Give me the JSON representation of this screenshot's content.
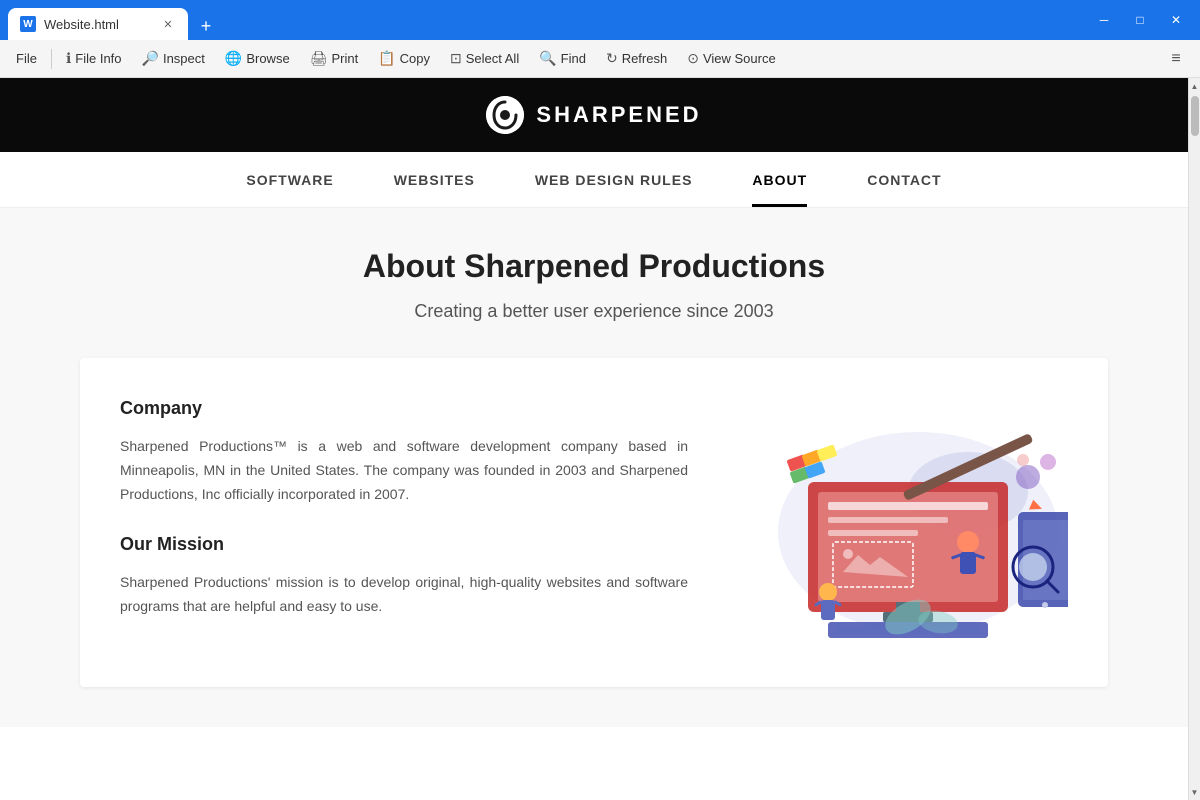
{
  "titlebar": {
    "tab_title": "Website.html",
    "new_tab_label": "+",
    "minimize_icon": "─",
    "restore_icon": "□",
    "close_icon": "✕"
  },
  "toolbar": {
    "file_label": "File",
    "file_info_label": "File Info",
    "inspect_label": "Inspect",
    "browse_label": "Browse",
    "print_label": "Print",
    "copy_label": "Copy",
    "select_all_label": "Select All",
    "find_label": "Find",
    "refresh_label": "Refresh",
    "view_source_label": "View Source",
    "menu_icon": "≡"
  },
  "site": {
    "logo_text": "SHARPENED",
    "logo_symbol": "S",
    "nav": [
      {
        "label": "SOFTWARE",
        "active": false
      },
      {
        "label": "WEBSITES",
        "active": false
      },
      {
        "label": "WEB DESIGN RULES",
        "active": false
      },
      {
        "label": "ABOUT",
        "active": true
      },
      {
        "label": "CONTACT",
        "active": false
      }
    ],
    "page_title": "About Sharpened Productions",
    "page_subtitle": "Creating a better user experience since 2003",
    "sections": [
      {
        "heading": "Company",
        "text": "Sharpened Productions™ is a web and software development company based in Minneapolis, MN in the United States. The company was founded in 2003 and Sharpened Productions, Inc officially incorporated in 2007."
      },
      {
        "heading": "Our Mission",
        "text": "Sharpened Productions' mission is to develop original, high-quality websites and software programs that are helpful and easy to use."
      }
    ]
  }
}
